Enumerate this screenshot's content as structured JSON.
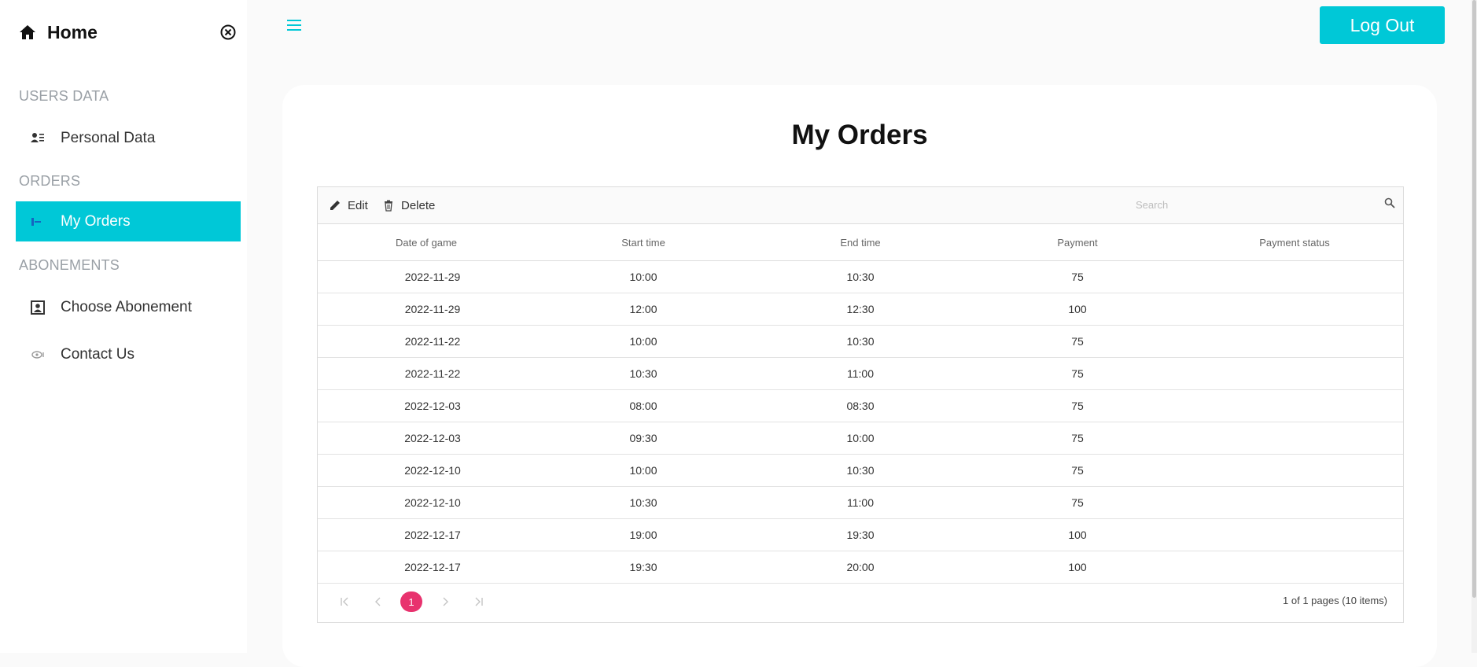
{
  "sidebar": {
    "home_label": "Home",
    "sections": {
      "users_data": "USERS DATA",
      "orders": "ORDERS",
      "abonements": "ABONEMENTS"
    },
    "items": {
      "personal_data": "Personal Data",
      "my_orders": "My Orders",
      "choose_abonement": "Choose Abonement",
      "contact_us": "Contact Us"
    }
  },
  "topbar": {
    "logout_label": "Log Out"
  },
  "page": {
    "title": "My Orders"
  },
  "grid": {
    "toolbar": {
      "edit_label": "Edit",
      "delete_label": "Delete",
      "search_placeholder": "Search"
    },
    "columns": [
      "Date of game",
      "Start time",
      "End time",
      "Payment",
      "Payment status"
    ],
    "rows": [
      [
        "2022-11-29",
        "10:00",
        "10:30",
        "75",
        ""
      ],
      [
        "2022-11-29",
        "12:00",
        "12:30",
        "100",
        ""
      ],
      [
        "2022-11-22",
        "10:00",
        "10:30",
        "75",
        ""
      ],
      [
        "2022-11-22",
        "10:30",
        "11:00",
        "75",
        ""
      ],
      [
        "2022-12-03",
        "08:00",
        "08:30",
        "75",
        ""
      ],
      [
        "2022-12-03",
        "09:30",
        "10:00",
        "75",
        ""
      ],
      [
        "2022-12-10",
        "10:00",
        "10:30",
        "75",
        ""
      ],
      [
        "2022-12-10",
        "10:30",
        "11:00",
        "75",
        ""
      ],
      [
        "2022-12-17",
        "19:00",
        "19:30",
        "100",
        ""
      ],
      [
        "2022-12-17",
        "19:30",
        "20:00",
        "100",
        ""
      ]
    ],
    "pager": {
      "current_page": "1",
      "info": "1 of 1 pages (10 items)"
    }
  },
  "colors": {
    "accent": "#00c8d7",
    "pager_active": "#e8326e"
  }
}
